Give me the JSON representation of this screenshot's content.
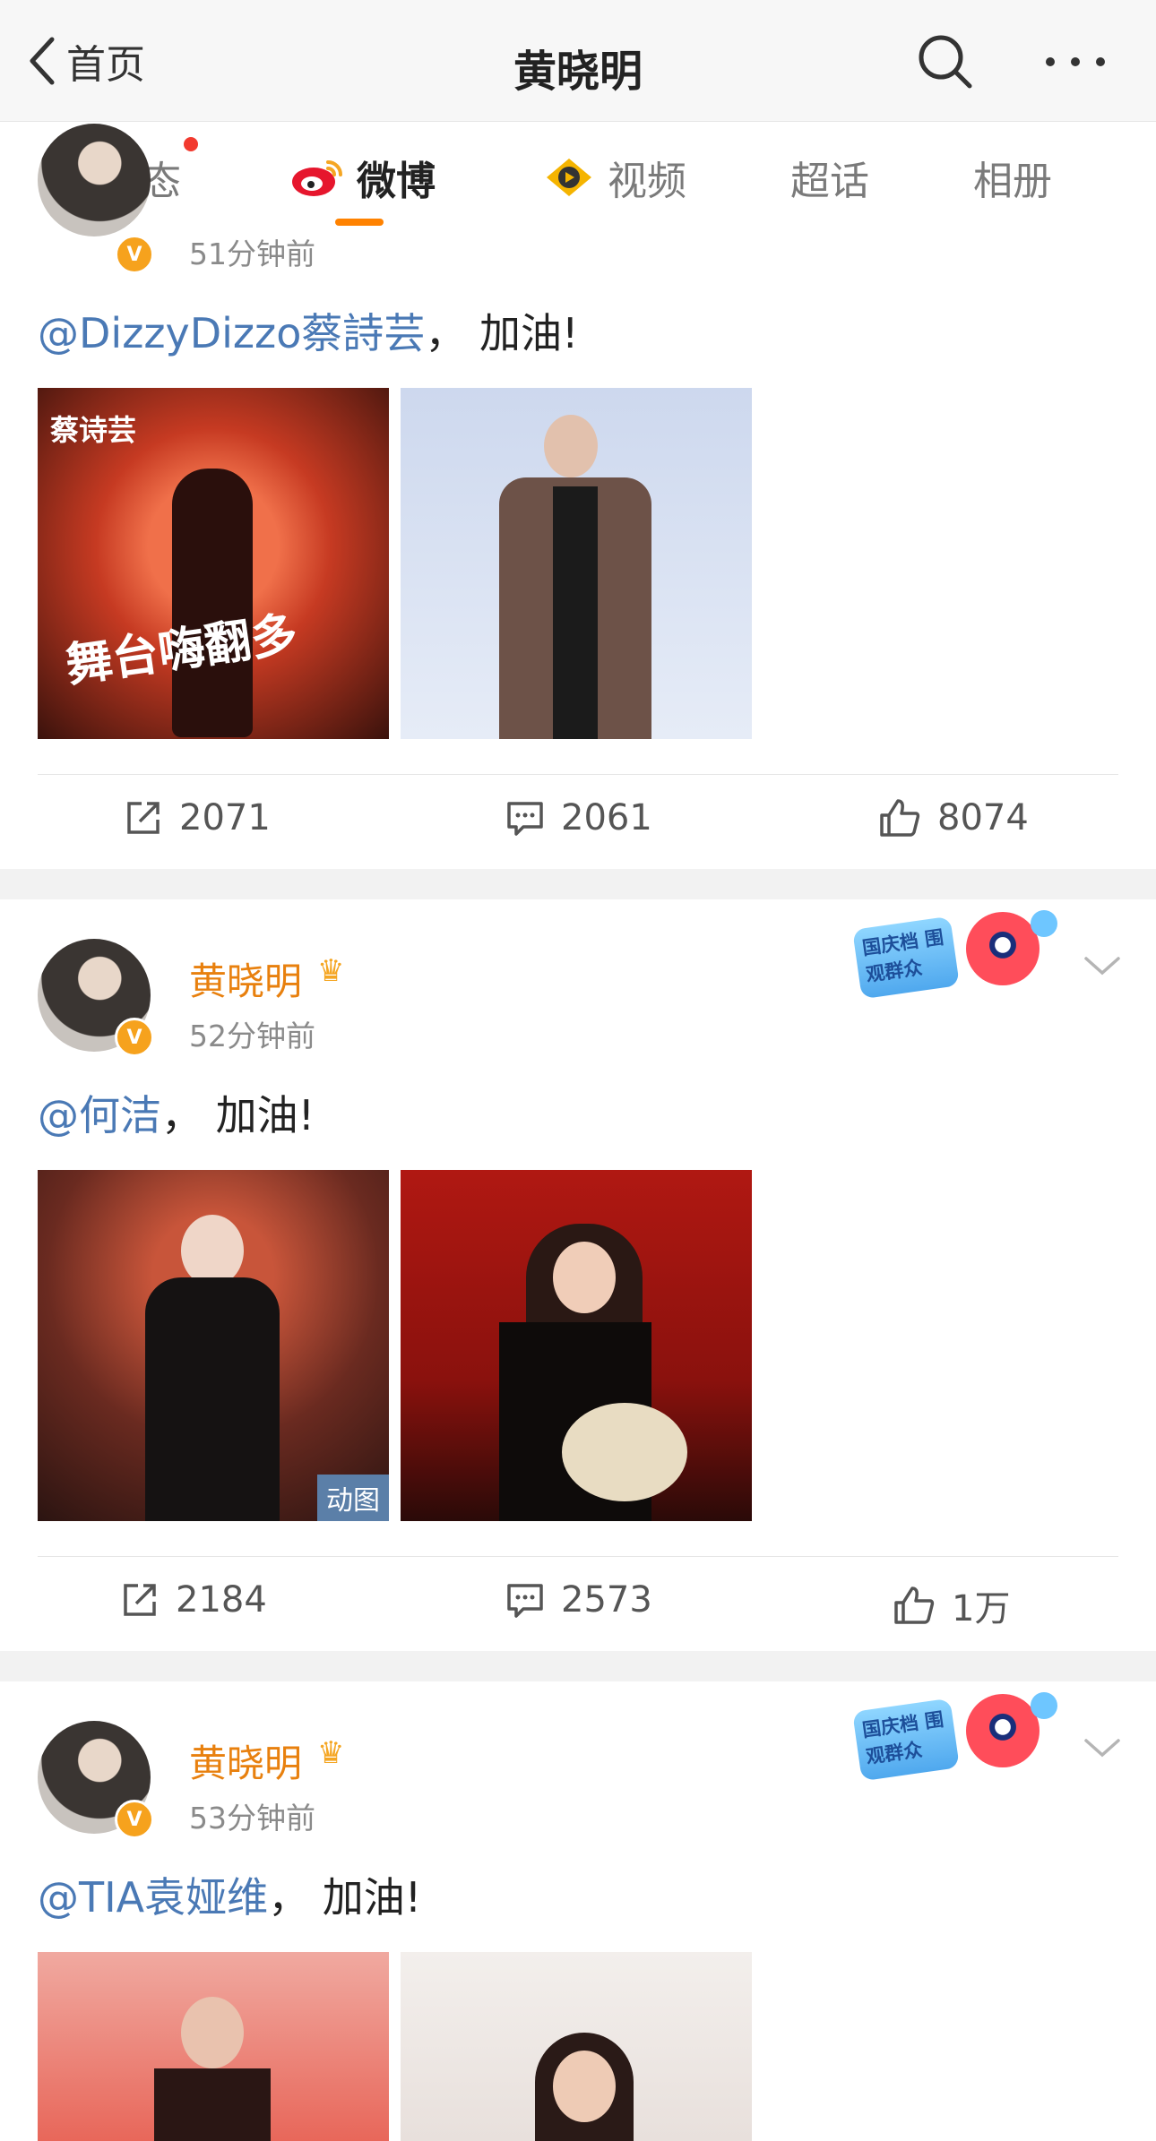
{
  "header": {
    "back_label": "首页",
    "title": "黄晓明"
  },
  "tabs": [
    {
      "label": "动态"
    },
    {
      "label": "微博"
    },
    {
      "label": "视频"
    },
    {
      "label": "超话"
    },
    {
      "label": "相册"
    }
  ],
  "posts": [
    {
      "time": "51分钟前",
      "mention": "@DizzyDizzo蔡詩芸",
      "text": "， 加油!",
      "images": [
        {
          "caption_top": "蔡诗芸",
          "caption_mid": "舞台嗨翻多"
        },
        {
          "caption_top": ""
        }
      ],
      "repost": "2071",
      "comment": "2061",
      "like": "8074"
    },
    {
      "username": "黄晓明",
      "time": "52分钟前",
      "mention": "@何洁",
      "text": "， 加油!",
      "sticker_text": "国庆档 围观群众",
      "images": [
        {
          "gif_tag": "动图"
        },
        {}
      ],
      "repost": "2184",
      "comment": "2573",
      "like": "1万"
    },
    {
      "username": "黄晓明",
      "time": "53分钟前",
      "mention": "@TIA袁娅维",
      "text": "， 加油!",
      "sticker_text": "国庆档 围观群众"
    }
  ],
  "colors": {
    "accent": "#ff8200",
    "mention": "#4a79b5",
    "username": "#e8800e",
    "badge": "#f6a21d"
  },
  "icons": [
    "chevron-left-icon",
    "search-icon",
    "more-icon",
    "weibo-icon",
    "video-icon",
    "repost-icon",
    "comment-icon",
    "like-icon",
    "verified-badge-icon",
    "crown-icon",
    "chevron-down-icon"
  ]
}
